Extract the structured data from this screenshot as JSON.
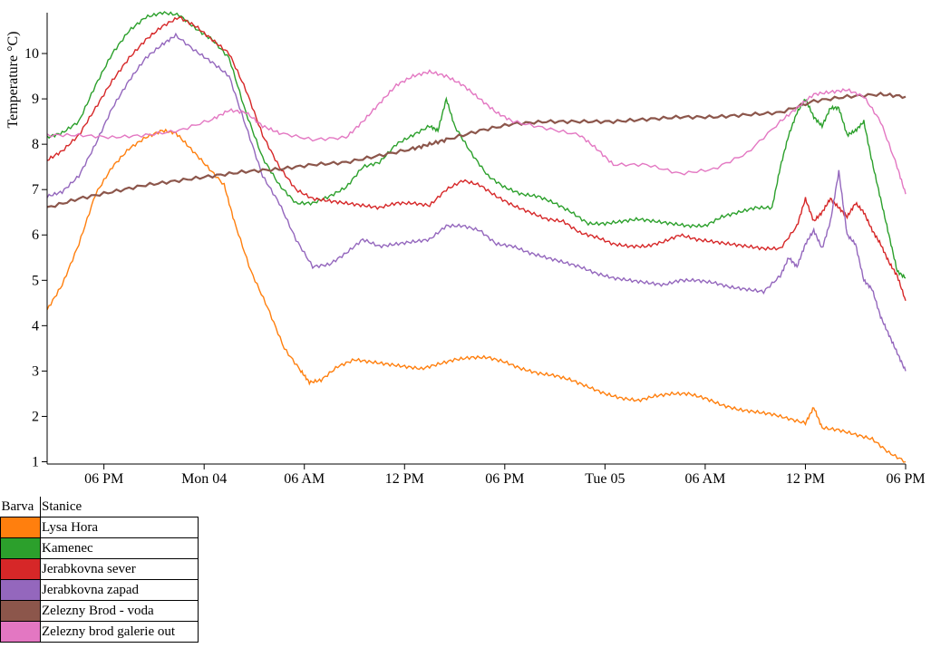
{
  "chart_data": {
    "type": "line",
    "xlabel": "",
    "ylabel": "Temperature °C)",
    "x_ticks": [
      "06 PM",
      "Mon 04",
      "06 AM",
      "12 PM",
      "06 PM",
      "Tue 05",
      "06 AM",
      "12 PM",
      "06 PM"
    ],
    "x_tick_hours": [
      0,
      6,
      12,
      18,
      24,
      30,
      36,
      42,
      48
    ],
    "xlim_hours": [
      -3.4,
      48
    ],
    "y_ticks": [
      1,
      2,
      3,
      4,
      5,
      6,
      7,
      8,
      9,
      10
    ],
    "ylim": [
      0.95,
      10.9
    ],
    "grid": false,
    "legend": "bottom-left table",
    "series": [
      {
        "name": "Lysa Hora",
        "color": "#ff7f0e",
        "points": [
          [
            -3.4,
            4.35
          ],
          [
            -2.5,
            4.9
          ],
          [
            -1.5,
            5.8
          ],
          [
            -0.5,
            6.9
          ],
          [
            0.5,
            7.5
          ],
          [
            1.5,
            7.9
          ],
          [
            2.5,
            8.15
          ],
          [
            3.5,
            8.3
          ],
          [
            4.3,
            8.25
          ],
          [
            5.2,
            7.9
          ],
          [
            6.2,
            7.5
          ],
          [
            7.2,
            7.1
          ],
          [
            7.8,
            6.3
          ],
          [
            8.8,
            5.2
          ],
          [
            9.8,
            4.4
          ],
          [
            10.8,
            3.5
          ],
          [
            11.8,
            3.0
          ],
          [
            12.3,
            2.75
          ],
          [
            13.0,
            2.8
          ],
          [
            14.0,
            3.1
          ],
          [
            15.0,
            3.25
          ],
          [
            16.0,
            3.2
          ],
          [
            17.0,
            3.15
          ],
          [
            18.0,
            3.1
          ],
          [
            19.0,
            3.05
          ],
          [
            20.0,
            3.15
          ],
          [
            21.0,
            3.25
          ],
          [
            22.0,
            3.3
          ],
          [
            23.0,
            3.3
          ],
          [
            24.0,
            3.2
          ],
          [
            25.0,
            3.05
          ],
          [
            26.0,
            2.95
          ],
          [
            27.0,
            2.9
          ],
          [
            28.0,
            2.8
          ],
          [
            29.0,
            2.65
          ],
          [
            30.0,
            2.5
          ],
          [
            31.0,
            2.4
          ],
          [
            32.0,
            2.35
          ],
          [
            33.0,
            2.45
          ],
          [
            34.0,
            2.5
          ],
          [
            35.0,
            2.5
          ],
          [
            36.0,
            2.4
          ],
          [
            37.0,
            2.25
          ],
          [
            38.0,
            2.15
          ],
          [
            39.0,
            2.1
          ],
          [
            40.0,
            2.05
          ],
          [
            41.0,
            1.95
          ],
          [
            42.0,
            1.85
          ],
          [
            42.5,
            2.2
          ],
          [
            43.0,
            1.75
          ],
          [
            44.0,
            1.7
          ],
          [
            45.0,
            1.6
          ],
          [
            46.0,
            1.5
          ],
          [
            47.0,
            1.2
          ],
          [
            48.0,
            1.0
          ]
        ]
      },
      {
        "name": "Kamenec",
        "color": "#2ca02c",
        "points": [
          [
            -3.4,
            8.15
          ],
          [
            -2.5,
            8.25
          ],
          [
            -1.5,
            8.5
          ],
          [
            -0.5,
            9.3
          ],
          [
            0.5,
            10.0
          ],
          [
            1.5,
            10.5
          ],
          [
            2.5,
            10.8
          ],
          [
            3.5,
            10.9
          ],
          [
            4.5,
            10.85
          ],
          [
            5.5,
            10.55
          ],
          [
            6.5,
            10.3
          ],
          [
            7.5,
            9.9
          ],
          [
            8.5,
            8.7
          ],
          [
            9.5,
            7.7
          ],
          [
            10.5,
            7.1
          ],
          [
            11.5,
            6.7
          ],
          [
            12.5,
            6.7
          ],
          [
            13.5,
            6.85
          ],
          [
            14.5,
            7.05
          ],
          [
            15.5,
            7.5
          ],
          [
            16.5,
            7.6
          ],
          [
            17.5,
            8.0
          ],
          [
            18.5,
            8.2
          ],
          [
            19.5,
            8.4
          ],
          [
            20.0,
            8.3
          ],
          [
            20.5,
            9.0
          ],
          [
            21.0,
            8.4
          ],
          [
            22.0,
            7.8
          ],
          [
            23.0,
            7.3
          ],
          [
            24.0,
            7.05
          ],
          [
            25.0,
            6.9
          ],
          [
            26.0,
            6.85
          ],
          [
            27.0,
            6.7
          ],
          [
            28.0,
            6.5
          ],
          [
            29.0,
            6.25
          ],
          [
            30.0,
            6.25
          ],
          [
            31.0,
            6.3
          ],
          [
            32.0,
            6.35
          ],
          [
            33.0,
            6.3
          ],
          [
            34.0,
            6.25
          ],
          [
            35.0,
            6.2
          ],
          [
            36.0,
            6.2
          ],
          [
            37.0,
            6.4
          ],
          [
            38.0,
            6.5
          ],
          [
            39.0,
            6.6
          ],
          [
            40.0,
            6.6
          ],
          [
            40.5,
            7.5
          ],
          [
            41.0,
            8.2
          ],
          [
            41.5,
            8.7
          ],
          [
            42.0,
            9.0
          ],
          [
            42.5,
            8.6
          ],
          [
            43.0,
            8.4
          ],
          [
            43.5,
            8.8
          ],
          [
            44.0,
            8.8
          ],
          [
            44.5,
            8.2
          ],
          [
            45.0,
            8.3
          ],
          [
            45.5,
            8.5
          ],
          [
            46.0,
            7.6
          ],
          [
            46.5,
            6.8
          ],
          [
            47.0,
            6.0
          ],
          [
            47.5,
            5.2
          ],
          [
            48.0,
            5.05
          ]
        ]
      },
      {
        "name": "Jerabkovna sever",
        "color": "#d62728",
        "points": [
          [
            -3.4,
            7.65
          ],
          [
            -2.5,
            7.85
          ],
          [
            -1.5,
            8.2
          ],
          [
            -0.5,
            8.8
          ],
          [
            0.5,
            9.4
          ],
          [
            1.5,
            9.9
          ],
          [
            2.5,
            10.3
          ],
          [
            3.5,
            10.6
          ],
          [
            4.5,
            10.8
          ],
          [
            5.5,
            10.6
          ],
          [
            6.5,
            10.3
          ],
          [
            7.5,
            10.0
          ],
          [
            8.5,
            9.2
          ],
          [
            9.5,
            8.2
          ],
          [
            10.5,
            7.5
          ],
          [
            11.5,
            7.0
          ],
          [
            12.5,
            6.8
          ],
          [
            13.5,
            6.75
          ],
          [
            14.5,
            6.7
          ],
          [
            15.5,
            6.65
          ],
          [
            16.5,
            6.6
          ],
          [
            17.5,
            6.7
          ],
          [
            18.5,
            6.7
          ],
          [
            19.5,
            6.65
          ],
          [
            20.5,
            7.0
          ],
          [
            21.5,
            7.2
          ],
          [
            22.5,
            7.1
          ],
          [
            23.5,
            6.85
          ],
          [
            24.5,
            6.65
          ],
          [
            25.5,
            6.5
          ],
          [
            26.5,
            6.35
          ],
          [
            27.5,
            6.3
          ],
          [
            28.5,
            6.05
          ],
          [
            29.5,
            5.95
          ],
          [
            30.5,
            5.8
          ],
          [
            31.5,
            5.75
          ],
          [
            32.5,
            5.75
          ],
          [
            33.5,
            5.85
          ],
          [
            34.5,
            6.0
          ],
          [
            35.5,
            5.9
          ],
          [
            36.5,
            5.85
          ],
          [
            37.5,
            5.8
          ],
          [
            38.5,
            5.75
          ],
          [
            39.5,
            5.7
          ],
          [
            40.5,
            5.7
          ],
          [
            41.5,
            6.2
          ],
          [
            42.0,
            6.8
          ],
          [
            42.5,
            6.3
          ],
          [
            43.0,
            6.5
          ],
          [
            43.5,
            6.8
          ],
          [
            44.0,
            6.6
          ],
          [
            44.5,
            6.4
          ],
          [
            45.0,
            6.7
          ],
          [
            45.5,
            6.5
          ],
          [
            46.0,
            6.1
          ],
          [
            46.5,
            5.8
          ],
          [
            47.0,
            5.4
          ],
          [
            47.5,
            5.1
          ],
          [
            48.0,
            4.55
          ]
        ]
      },
      {
        "name": "Jerabkovna zapad",
        "color": "#9467bd",
        "points": [
          [
            -3.4,
            6.85
          ],
          [
            -2.5,
            6.95
          ],
          [
            -1.5,
            7.3
          ],
          [
            -0.5,
            8.0
          ],
          [
            0.5,
            8.8
          ],
          [
            1.5,
            9.4
          ],
          [
            2.5,
            9.9
          ],
          [
            3.5,
            10.2
          ],
          [
            4.3,
            10.4
          ],
          [
            5.5,
            10.05
          ],
          [
            6.5,
            9.8
          ],
          [
            7.5,
            9.5
          ],
          [
            8.5,
            8.4
          ],
          [
            9.5,
            7.3
          ],
          [
            10.5,
            6.7
          ],
          [
            11.5,
            5.9
          ],
          [
            12.5,
            5.3
          ],
          [
            13.5,
            5.35
          ],
          [
            14.5,
            5.6
          ],
          [
            15.5,
            5.9
          ],
          [
            16.5,
            5.75
          ],
          [
            17.5,
            5.8
          ],
          [
            18.5,
            5.85
          ],
          [
            19.5,
            5.9
          ],
          [
            20.5,
            6.2
          ],
          [
            21.5,
            6.2
          ],
          [
            22.5,
            6.1
          ],
          [
            23.5,
            5.8
          ],
          [
            24.5,
            5.75
          ],
          [
            25.5,
            5.6
          ],
          [
            26.5,
            5.5
          ],
          [
            27.5,
            5.4
          ],
          [
            28.5,
            5.3
          ],
          [
            29.5,
            5.15
          ],
          [
            30.5,
            5.05
          ],
          [
            31.5,
            5.0
          ],
          [
            32.5,
            4.95
          ],
          [
            33.5,
            4.9
          ],
          [
            34.5,
            5.0
          ],
          [
            35.5,
            5.0
          ],
          [
            36.5,
            4.95
          ],
          [
            37.5,
            4.85
          ],
          [
            38.5,
            4.8
          ],
          [
            39.5,
            4.75
          ],
          [
            40.5,
            5.1
          ],
          [
            41.0,
            5.5
          ],
          [
            41.5,
            5.3
          ],
          [
            42.0,
            5.8
          ],
          [
            42.5,
            6.1
          ],
          [
            43.0,
            5.7
          ],
          [
            43.5,
            6.3
          ],
          [
            44.0,
            7.4
          ],
          [
            44.5,
            6.0
          ],
          [
            45.0,
            5.8
          ],
          [
            45.5,
            5.0
          ],
          [
            46.0,
            4.8
          ],
          [
            46.5,
            4.2
          ],
          [
            47.0,
            3.8
          ],
          [
            47.5,
            3.4
          ],
          [
            48.0,
            3.0
          ]
        ]
      },
      {
        "name": "Zelezny Brod - voda",
        "color": "#8c564b",
        "points": [
          [
            -3.4,
            6.6
          ],
          [
            -1.5,
            6.8
          ],
          [
            0.5,
            6.95
          ],
          [
            2.5,
            7.1
          ],
          [
            4.5,
            7.2
          ],
          [
            6.5,
            7.3
          ],
          [
            8.5,
            7.4
          ],
          [
            10.5,
            7.45
          ],
          [
            12.5,
            7.55
          ],
          [
            14.5,
            7.6
          ],
          [
            16.5,
            7.75
          ],
          [
            18.5,
            7.9
          ],
          [
            19.5,
            8.0
          ],
          [
            20.5,
            8.1
          ],
          [
            22.5,
            8.3
          ],
          [
            24.5,
            8.45
          ],
          [
            26.5,
            8.5
          ],
          [
            28.5,
            8.5
          ],
          [
            30.5,
            8.5
          ],
          [
            32.5,
            8.55
          ],
          [
            34.5,
            8.6
          ],
          [
            36.5,
            8.6
          ],
          [
            38.5,
            8.65
          ],
          [
            40.5,
            8.7
          ],
          [
            42.5,
            8.95
          ],
          [
            44.5,
            9.05
          ],
          [
            46.5,
            9.1
          ],
          [
            48.0,
            9.05
          ]
        ]
      },
      {
        "name": "Zelezny brod galerie out",
        "color": "#e377c2",
        "points": [
          [
            -3.4,
            8.2
          ],
          [
            -1.5,
            8.2
          ],
          [
            0.5,
            8.15
          ],
          [
            2.5,
            8.2
          ],
          [
            4.5,
            8.3
          ],
          [
            6.5,
            8.55
          ],
          [
            7.5,
            8.75
          ],
          [
            8.5,
            8.7
          ],
          [
            9.5,
            8.4
          ],
          [
            10.5,
            8.25
          ],
          [
            12.5,
            8.1
          ],
          [
            14.5,
            8.15
          ],
          [
            15.5,
            8.5
          ],
          [
            16.5,
            8.9
          ],
          [
            17.5,
            9.3
          ],
          [
            18.5,
            9.5
          ],
          [
            19.5,
            9.6
          ],
          [
            20.5,
            9.5
          ],
          [
            21.5,
            9.3
          ],
          [
            22.5,
            9.0
          ],
          [
            23.5,
            8.7
          ],
          [
            24.5,
            8.5
          ],
          [
            26.5,
            8.35
          ],
          [
            28.5,
            8.2
          ],
          [
            29.5,
            7.9
          ],
          [
            30.5,
            7.55
          ],
          [
            32.5,
            7.55
          ],
          [
            34.5,
            7.35
          ],
          [
            36.5,
            7.45
          ],
          [
            38.5,
            7.8
          ],
          [
            40.5,
            8.5
          ],
          [
            41.5,
            8.8
          ],
          [
            42.5,
            9.1
          ],
          [
            43.5,
            9.15
          ],
          [
            44.5,
            9.2
          ],
          [
            45.5,
            9.05
          ],
          [
            46.5,
            8.5
          ],
          [
            47.5,
            7.5
          ],
          [
            48.0,
            6.9
          ]
        ]
      }
    ]
  },
  "legend_table": {
    "col_color": "Barva",
    "col_station": "Stanice"
  }
}
